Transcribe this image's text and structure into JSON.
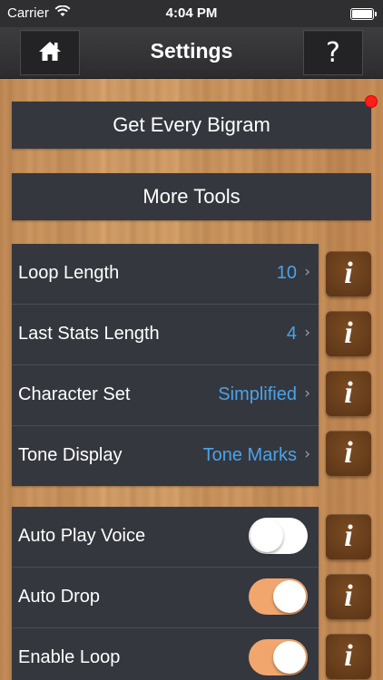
{
  "status_bar": {
    "carrier": "Carrier",
    "time": "4:04 PM"
  },
  "nav": {
    "title": "Settings",
    "help_label": "?"
  },
  "buttons": {
    "get_every_bigram": "Get Every Bigram",
    "more_tools": "More Tools"
  },
  "settings": [
    {
      "label": "Loop Length",
      "value": "10"
    },
    {
      "label": "Last Stats Length",
      "value": "4"
    },
    {
      "label": "Character Set",
      "value": "Simplified"
    },
    {
      "label": "Tone Display",
      "value": "Tone Marks"
    }
  ],
  "toggles": [
    {
      "label": "Auto Play Voice",
      "on": false
    },
    {
      "label": "Auto Drop",
      "on": true
    },
    {
      "label": "Enable Loop",
      "on": true
    }
  ],
  "info_label": "i",
  "colors": {
    "accent_blue": "#4aa3ea",
    "toggle_on": "#f1a66e",
    "info_brown": "#6a3f1b",
    "badge_red": "#ff1d1d"
  },
  "icons": {
    "home": "home-icon",
    "wifi": "wifi-icon",
    "battery": "battery-icon",
    "chevron": "chevron-right-icon"
  }
}
